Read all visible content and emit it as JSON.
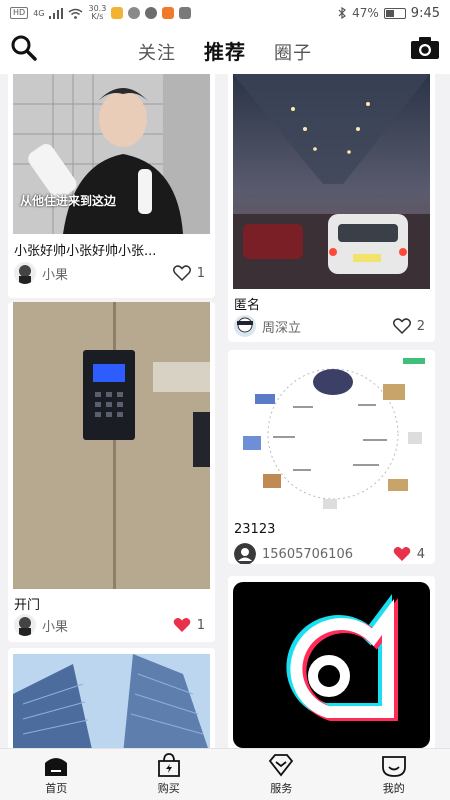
{
  "status_bar": {
    "left_chip": "HD",
    "signal_label": "4G",
    "net_speed": "30.3",
    "net_unit": "K/s",
    "battery": "47%",
    "battery_level": 0.47,
    "time": "9:45"
  },
  "header": {
    "tabs": [
      {
        "label": "关注",
        "active": false
      },
      {
        "label": "推荐",
        "active": true
      },
      {
        "label": "圈子",
        "active": false
      }
    ],
    "search_icon": "search-icon",
    "camera_icon": "camera-icon"
  },
  "feed": {
    "cards": [
      {
        "id": "c1",
        "caption_overlay": "从他住进来到这边",
        "title": "小张好帅小张好帅小张...",
        "author": "小果",
        "likes": "1",
        "liked": false
      },
      {
        "id": "c2",
        "title": "匿名",
        "author": "周深立",
        "likes": "2",
        "liked": false
      },
      {
        "id": "c3",
        "title": "开门",
        "author": "小果",
        "likes": "1",
        "liked": true
      },
      {
        "id": "c4",
        "title": "23123",
        "author": "15605706106",
        "likes": "4",
        "liked": true
      },
      {
        "id": "c5",
        "title": "",
        "author": "",
        "likes": "",
        "liked": false
      },
      {
        "id": "c6",
        "title": "",
        "author": "",
        "likes": "",
        "liked": false
      }
    ]
  },
  "nav": {
    "items": [
      {
        "label": "首页",
        "icon": "home-icon"
      },
      {
        "label": "购买",
        "icon": "shopping-bag-icon"
      },
      {
        "label": "服务",
        "icon": "diamond-icon"
      },
      {
        "label": "我的",
        "icon": "profile-face-icon"
      }
    ]
  },
  "colors": {
    "like_active": "#e8314a",
    "like_inactive": "#333333"
  }
}
